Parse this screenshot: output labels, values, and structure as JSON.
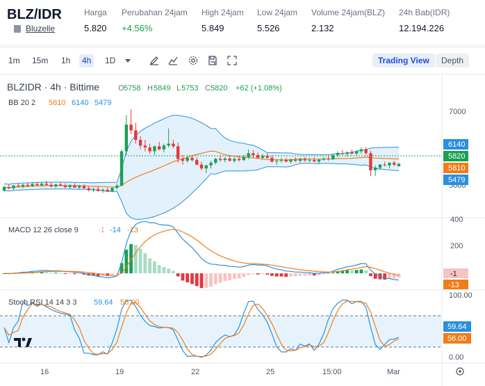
{
  "header": {
    "pair": "BLZ/IDR",
    "exchange_name": "Bluzelle",
    "stats": [
      {
        "label": "Harga",
        "value": "5.820",
        "trend": "neutral"
      },
      {
        "label": "Perubahan 24jam",
        "value": "+4.56%",
        "trend": "up"
      },
      {
        "label": "High 24jam",
        "value": "5.849",
        "trend": "neutral"
      },
      {
        "label": "Low 24jam",
        "value": "5.526",
        "trend": "neutral"
      },
      {
        "label": "Volume 24jam(BLZ)",
        "value": "2.132",
        "trend": "neutral"
      },
      {
        "label": "24h Bab(IDR)",
        "value": "12.194.226",
        "trend": "neutral"
      }
    ]
  },
  "toolbar": {
    "timeframes": [
      {
        "label": "1m",
        "active": false
      },
      {
        "label": "15m",
        "active": false
      },
      {
        "label": "1h",
        "active": false
      },
      {
        "label": "4h",
        "active": true
      },
      {
        "label": "1D",
        "active": false
      }
    ],
    "icons": [
      "dropdown-caret-icon",
      "draw-pen-icon",
      "indicator-icon",
      "settings-icon",
      "save-icon",
      "fullscreen-icon"
    ],
    "trading_view_label": "Trading View",
    "depth_label": "Depth"
  },
  "chart": {
    "title": "BLZIDR · 4h · Bittime",
    "ohlc": {
      "o_label": "O",
      "o": "5758",
      "h_label": "H",
      "h": "5849",
      "l_label": "L",
      "l": "5753",
      "c_label": "C",
      "c": "5820",
      "change": "+62 (+1.08%)"
    },
    "bb": {
      "label": "BB 20 2",
      "basis": "5810",
      "upper": "6140",
      "lower": "5479"
    },
    "price_axis": [
      "7000",
      "6000",
      "5000"
    ],
    "price_tags": [
      {
        "value": "6140",
        "color": "#2a8fe0"
      },
      {
        "value": "5820",
        "color": "#1aa053"
      },
      {
        "value": "5810",
        "color": "#f07d19"
      },
      {
        "value": "5479",
        "color": "#2a8fe0"
      }
    ],
    "macd": {
      "label": "MACD 12 26 close 9",
      "hist": "-1",
      "macd": "-14",
      "signal": "-13",
      "axis": [
        "400",
        "200"
      ],
      "tag_hist": "-1",
      "tag_signal": "-13"
    },
    "stoch": {
      "label": "Stoch RSI 14 14 3 3",
      "k": "59.64",
      "d": "56.00",
      "axis": [
        "100.00",
        "0.00"
      ],
      "tag_k": "59.64",
      "tag_d": "56.00"
    },
    "time_axis": [
      "16",
      "19",
      "22",
      "25",
      "15:00",
      "Mar"
    ],
    "watermark": "TV-logo"
  },
  "chart_data": {
    "type": "candlestick",
    "title": "BLZIDR · 4h · Bittime",
    "ylim": [
      4500,
      7600
    ],
    "candles": [
      [
        5120,
        5240,
        5090,
        5210
      ],
      [
        5210,
        5280,
        5150,
        5180
      ],
      [
        5180,
        5270,
        5140,
        5250
      ],
      [
        5250,
        5320,
        5200,
        5230
      ],
      [
        5230,
        5300,
        5180,
        5270
      ],
      [
        5270,
        5330,
        5220,
        5240
      ],
      [
        5240,
        5320,
        5210,
        5290
      ],
      [
        5290,
        5350,
        5240,
        5260
      ],
      [
        5260,
        5330,
        5220,
        5300
      ],
      [
        5300,
        5380,
        5260,
        5270
      ],
      [
        5270,
        5340,
        5200,
        5230
      ],
      [
        5230,
        5300,
        5190,
        5280
      ],
      [
        5280,
        5350,
        5230,
        5250
      ],
      [
        5250,
        5310,
        5180,
        5210
      ],
      [
        5210,
        5290,
        5170,
        5260
      ],
      [
        5260,
        5310,
        5190,
        5200
      ],
      [
        5200,
        5270,
        5150,
        5240
      ],
      [
        5240,
        5290,
        5170,
        5180
      ],
      [
        5180,
        5240,
        5100,
        5130
      ],
      [
        5130,
        5200,
        5080,
        5160
      ],
      [
        5160,
        5230,
        5090,
        5110
      ],
      [
        5110,
        5180,
        5060,
        5140
      ],
      [
        5140,
        5200,
        5080,
        5100
      ],
      [
        5100,
        5200,
        5080,
        5190
      ],
      [
        5190,
        5300,
        5150,
        5250
      ],
      [
        5250,
        6200,
        5230,
        6150
      ],
      [
        6150,
        7100,
        6050,
        6850
      ],
      [
        6850,
        7250,
        6600,
        6700
      ],
      [
        6700,
        6900,
        6350,
        6450
      ],
      [
        6450,
        6550,
        6200,
        6300
      ],
      [
        6300,
        6450,
        6150,
        6250
      ],
      [
        6250,
        6350,
        6080,
        6150
      ],
      [
        6150,
        6300,
        6050,
        6280
      ],
      [
        6280,
        6400,
        6180,
        6200
      ],
      [
        6200,
        6350,
        6120,
        6300
      ],
      [
        6300,
        6750,
        6250,
        6350
      ],
      [
        6350,
        6450,
        6230,
        6280
      ],
      [
        6280,
        6380,
        5850,
        5950
      ],
      [
        5950,
        6050,
        5800,
        5900
      ],
      [
        5900,
        6020,
        5850,
        5980
      ],
      [
        5980,
        6050,
        5880,
        5920
      ],
      [
        5920,
        5990,
        5780,
        5800
      ],
      [
        5800,
        5880,
        5650,
        5700
      ],
      [
        5700,
        5800,
        5580,
        5780
      ],
      [
        5780,
        5900,
        5700,
        5850
      ],
      [
        5850,
        5980,
        5800,
        5950
      ],
      [
        5950,
        6050,
        5880,
        5920
      ],
      [
        5920,
        6000,
        5860,
        5960
      ],
      [
        5960,
        6050,
        5880,
        5900
      ],
      [
        5900,
        5990,
        5850,
        5950
      ],
      [
        5950,
        6030,
        5880,
        5920
      ],
      [
        5920,
        6050,
        5900,
        6000
      ],
      [
        6000,
        6200,
        5950,
        6100
      ],
      [
        6100,
        6180,
        5980,
        6050
      ],
      [
        6050,
        6120,
        5950,
        5980
      ],
      [
        5980,
        6080,
        5930,
        6030
      ],
      [
        6030,
        6100,
        5960,
        5980
      ],
      [
        5980,
        6040,
        5850,
        5880
      ],
      [
        5880,
        5950,
        5800,
        5900
      ],
      [
        5900,
        5980,
        5850,
        5920
      ],
      [
        5920,
        5980,
        5860,
        5880
      ],
      [
        5880,
        5960,
        5830,
        5930
      ],
      [
        5930,
        5990,
        5870,
        5900
      ],
      [
        5900,
        5980,
        5850,
        5940
      ],
      [
        5940,
        6000,
        5880,
        5910
      ],
      [
        5910,
        5970,
        5860,
        5920
      ],
      [
        5920,
        5990,
        5870,
        5880
      ],
      [
        5880,
        5950,
        5830,
        5930
      ],
      [
        5930,
        6000,
        5900,
        5960
      ],
      [
        5960,
        6030,
        5900,
        5940
      ],
      [
        5940,
        6080,
        5920,
        6050
      ],
      [
        6050,
        6150,
        6000,
        6100
      ],
      [
        6100,
        6180,
        6050,
        6080
      ],
      [
        6080,
        6150,
        6020,
        6120
      ],
      [
        6120,
        6200,
        6060,
        6090
      ],
      [
        6090,
        6180,
        6040,
        6150
      ],
      [
        6150,
        6250,
        6080,
        6200
      ],
      [
        6200,
        6260,
        6050,
        6100
      ],
      [
        6100,
        6160,
        5500,
        5650
      ],
      [
        5650,
        5780,
        5500,
        5720
      ],
      [
        5720,
        5820,
        5650,
        5800
      ],
      [
        5800,
        5880,
        5750,
        5780
      ],
      [
        5780,
        5860,
        5700,
        5850
      ],
      [
        5850,
        5900,
        5760,
        5800
      ],
      [
        5758,
        5849,
        5753,
        5820
      ]
    ]
  }
}
